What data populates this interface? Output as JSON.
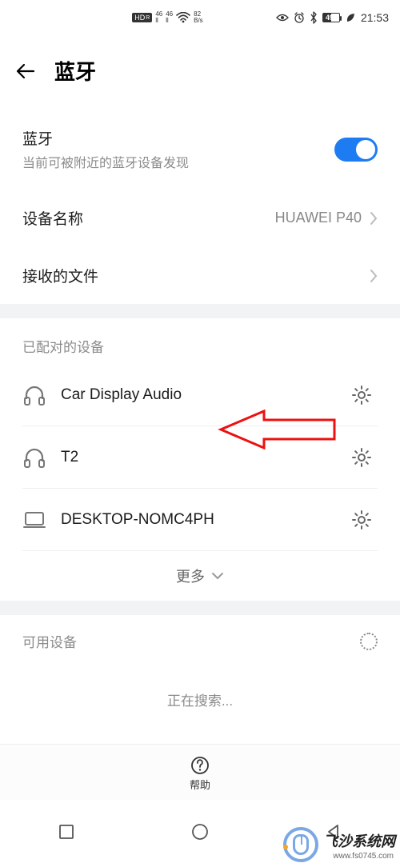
{
  "status": {
    "hd": "HD",
    "hd_sub": "R",
    "sig1_top": "46",
    "sig2_top": "46",
    "speed_top": "82",
    "speed_bot": "B/s",
    "battery_num": "49",
    "time": "21:53"
  },
  "header": {
    "title": "蓝牙"
  },
  "bluetooth": {
    "title": "蓝牙",
    "subtitle": "当前可被附近的蓝牙设备发现"
  },
  "device_name": {
    "label": "设备名称",
    "value": "HUAWEI P40"
  },
  "received_files": {
    "label": "接收的文件"
  },
  "paired": {
    "section_label": "已配对的设备",
    "devices": [
      {
        "name": "Car Display Audio",
        "icon": "headphones"
      },
      {
        "name": "T2",
        "icon": "headphones"
      },
      {
        "name": "DESKTOP-NOMC4PH",
        "icon": "laptop"
      }
    ],
    "more": "更多"
  },
  "available": {
    "label": "可用设备",
    "searching": "正在搜索..."
  },
  "help": {
    "label": "帮助"
  },
  "watermark": {
    "brand": "飞沙系统网",
    "url": "www.fs0745.com"
  }
}
